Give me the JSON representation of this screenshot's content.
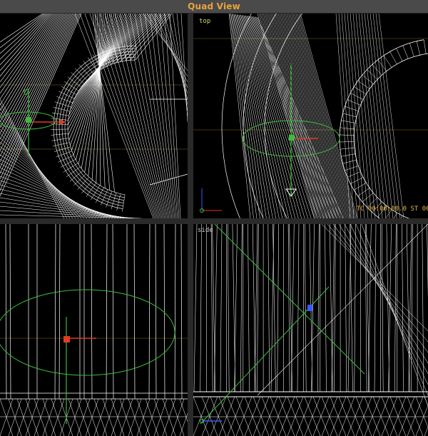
{
  "window": {
    "title": "Quad View"
  },
  "viewports": {
    "top_left": {
      "label": ""
    },
    "top_right": {
      "label": "top",
      "timecode": "TC 00:00:00.0  ST 00:"
    },
    "bottom_left": {
      "label": ""
    },
    "bottom_right": {
      "label": "side"
    }
  },
  "colors": {
    "title": "#e8a33b",
    "wire": "#ffffff",
    "green": "#3dbb3d",
    "red": "#e23b22",
    "blue": "#3a59ff",
    "grid": "#8a6a2b",
    "bg": "#000000"
  }
}
